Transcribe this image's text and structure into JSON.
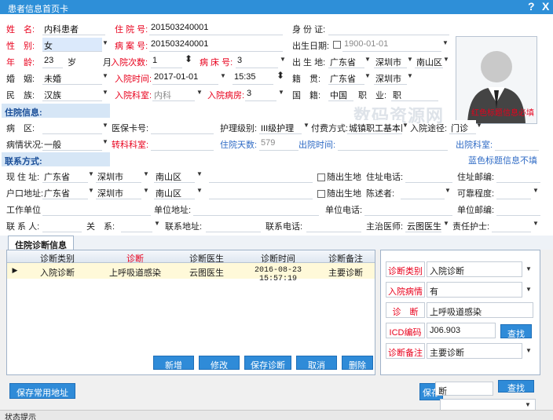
{
  "window": {
    "title": "患者信息首页卡",
    "help": "?",
    "close": "X"
  },
  "patient": {
    "name_label": "姓　名:",
    "name": "内科患者",
    "gender_label": "性　别:",
    "gender": "女",
    "age_label": "年　龄:",
    "age": "23",
    "age_unit": "岁",
    "marriage_label": "婚　姻:",
    "marriage": "未婚",
    "ethnicity_label": "民　族:",
    "ethnicity": "汉族",
    "inpatient_no_label": "住 院 号:",
    "inpatient_no": "201503240001",
    "ward_no_label": "病 案 号:",
    "ward_no": "201503240001",
    "month_label": "月",
    "admit_count_label": "入院次数:",
    "admit_count": "1",
    "bed_label": "病 床 号:",
    "bed": "3",
    "admit_time_label": "入院时间:",
    "admit_date": "2017-01-01",
    "admit_clock": "15:35",
    "admit_dept_label": "入院科室:",
    "admit_dept": "内科",
    "admit_ward_label": "入院病房:",
    "admit_ward": "3",
    "id_label": "身 份 证:",
    "birth_label": "出生日期:",
    "birth": "1900-01-01",
    "birthplace_label": "出 生 地:",
    "birthplace_province": "广东省",
    "birthplace_city": "深圳市",
    "birthplace_district": "南山区",
    "native_label": "籍　贯:",
    "native_province": "广东省",
    "native_city": "深圳市",
    "nationality_label": "国　籍:",
    "nationality": "中国",
    "occupation_label": "职　业:",
    "occupation": "职"
  },
  "photo": {
    "note": "红色标题信息必填"
  },
  "watermark": "数码资源网",
  "stay": {
    "section": "住院信息:",
    "disease_label": "病　区:",
    "insurance_label": "医保卡号:",
    "nursing_label": "护理级别:",
    "nursing": "III级护理",
    "payment_label": "付费方式:",
    "payment": "城镇职工基本医",
    "admit_way_label": "入院途径:",
    "admit_way": "门诊",
    "condition_label": "病情状况:",
    "condition": "一般",
    "transfer_label": "转科科室:",
    "days_label": "住院天数:",
    "days": "579",
    "discharge_time_label": "出院时间:",
    "discharge_dept_label": "出院科室:"
  },
  "contact": {
    "section": "联系方式:",
    "note": "蓝色标题信息不填",
    "address_label": "现 住 址:",
    "province": "广东省",
    "city": "深圳市",
    "district": "南山区",
    "birthplace_chk": "随出生地",
    "address_phone_label": "住址电话:",
    "address_zip_label": "住址邮编:",
    "hukou_label": "户口地址:",
    "hukou_province": "广东省",
    "hukou_city": "深圳市",
    "hukou_district": "南山区",
    "hukou_chk": "随出生地",
    "narrator_label": "陈述者:",
    "reliability_label": "可靠程度:",
    "work_label": "工作单位",
    "work_address_label": "单位地址:",
    "work_phone_label": "单位电话:",
    "work_zip_label": "单位邮编:",
    "contact_label": "联 系 人:",
    "relation_label": "关　系:",
    "contact_addr_label": "联系地址:",
    "contact_phone_label": "联系电话:",
    "doctor_label": "主治医师:",
    "doctor": "云图医生",
    "nurse_label": "责任护士:"
  },
  "diagnosis": {
    "tab": "住院诊断信息",
    "columns": [
      "诊断类别",
      "诊断",
      "诊断医生",
      "诊断时间",
      "诊断备注"
    ],
    "rows": [
      {
        "type": "入院诊断",
        "diagnosis": "上呼吸道感染",
        "doctor": "云图医生",
        "time": "2016-08-23 15:57:19",
        "note": "主要诊断"
      }
    ],
    "buttons": {
      "add": "新增",
      "edit": "修改",
      "save": "保存诊断",
      "cancel": "取消",
      "delete": "删除"
    }
  },
  "detail": {
    "type_label": "诊断类别",
    "type": "入院诊断",
    "condition_label": "入院病情",
    "condition": "有",
    "diagnosis_label": "诊　断",
    "diagnosis": "上呼吸道感染",
    "icd_label": "ICD编码",
    "icd": "J06.903",
    "search": "查找",
    "note_label": "诊断备注",
    "note": "主要诊断"
  },
  "footer": {
    "save_address": "保存常用地址",
    "save_short": "保存",
    "field_value": "断",
    "search": "查找"
  },
  "status": {
    "text": "状态提示"
  },
  "colors": {
    "accent": "#2e8fd8",
    "required": "#e8001c",
    "info": "#2f6bc5"
  }
}
